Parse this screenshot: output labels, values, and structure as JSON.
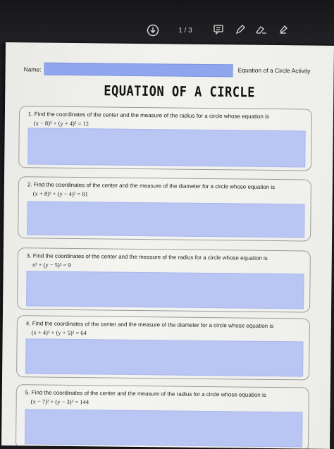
{
  "viewer": {
    "page_counter": "1 / 3",
    "icons": [
      "download-icon",
      "comment-icon",
      "pen-icon",
      "eraser-icon",
      "stamp-icon"
    ]
  },
  "worksheet": {
    "name_label": "Name:",
    "activity_title": "Equation of a Circle Activity",
    "title": "EQUATION OF A CIRCLE",
    "questions": [
      {
        "text": "1.  Find the coordinates of the center and the measure of the radius for a circle whose equation is",
        "equation": "(x − 8)² + (y + 4)² = 12"
      },
      {
        "text": "2.  Find the coordinates of the center and the measure of the diameter for a circle whose equation is",
        "equation": "(x + 8)² + (y − 4)² = 81"
      },
      {
        "text": "3.  Find the coordinates of the center and the measure of the radius for a circle whose equation is",
        "equation": "x² + (y − 5)² = 9"
      },
      {
        "text": "4.  Find the coordinates of the center and the measure of the diameter for a circle whose equation is",
        "equation": "(x + 4)² + (y + 5)² = 64"
      },
      {
        "text": "5.  Find the coordinates of the center and the measure of the radius for a circle whose equation is",
        "equation": "(x − 7)² + (y − 3)² = 144"
      }
    ]
  },
  "colors": {
    "answer_fill": "#b9c5f3",
    "name_fill": "#8fa6ee"
  }
}
